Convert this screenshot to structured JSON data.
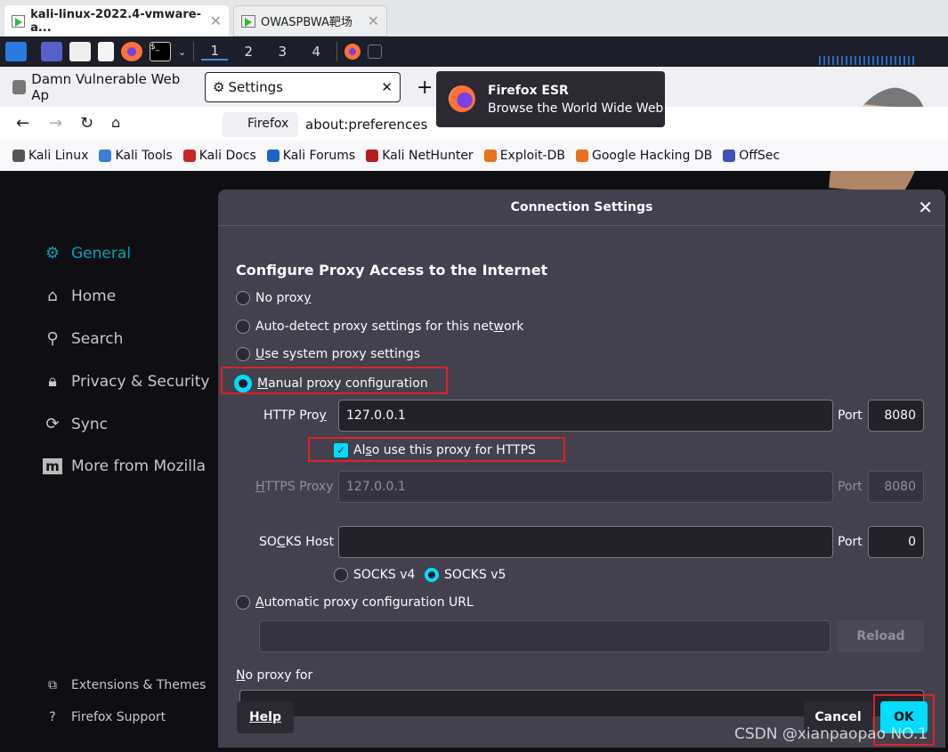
{
  "host_tabs": [
    {
      "label": "kali-linux-2022.4-vmware-a...",
      "active": true
    },
    {
      "label": "OWASPBWA靶场",
      "active": false
    }
  ],
  "panel": {
    "workspaces": [
      "1",
      "2",
      "3",
      "4"
    ]
  },
  "browser_tabs": [
    {
      "label": "Damn Vulnerable Web Ap"
    },
    {
      "label": "Settings",
      "active": true
    }
  ],
  "tooltip": {
    "title": "Firefox ESR",
    "subtitle": "Browse the World Wide Web"
  },
  "navbar": {
    "identity": "Firefox",
    "url": "about:preferences"
  },
  "bookmarks": [
    {
      "label": "Kali Linux",
      "color": "#555"
    },
    {
      "label": "Kali Tools",
      "color": "#3b7dd8"
    },
    {
      "label": "Kali Docs",
      "color": "#c62828"
    },
    {
      "label": "Kali Forums",
      "color": "#1e64c8"
    },
    {
      "label": "Kali NetHunter",
      "color": "#b71c1c"
    },
    {
      "label": "Exploit-DB",
      "color": "#e8711c"
    },
    {
      "label": "Google Hacking DB",
      "color": "#e8711c"
    },
    {
      "label": "OffSec",
      "color": "#3f51b5"
    }
  ],
  "sidebar": {
    "items": [
      {
        "label": "General",
        "icon": "gear-icon",
        "active": true
      },
      {
        "label": "Home",
        "icon": "home-icon"
      },
      {
        "label": "Search",
        "icon": "search-icon"
      },
      {
        "label": "Privacy & Security",
        "icon": "lock-icon"
      },
      {
        "label": "Sync",
        "icon": "sync-icon"
      },
      {
        "label": "More from Mozilla",
        "icon": "mozilla-icon"
      }
    ],
    "footer": [
      {
        "label": "Extensions & Themes",
        "icon": "puzzle-icon"
      },
      {
        "label": "Firefox Support",
        "icon": "help-icon"
      }
    ]
  },
  "dialog": {
    "title": "Connection Settings",
    "heading": "Configure Proxy Access to the Internet",
    "options": {
      "no_proxy": "No prox",
      "auto_detect_a": "Auto-detect proxy settings for this net",
      "auto_detect_b": "ork",
      "system_b": "se system proxy settings",
      "manual_b": "anual proxy configuration",
      "auto_url_b": "utomatic proxy configuration URL"
    },
    "selected": "manual",
    "http_proxy": {
      "label_a": "HTTP Pro",
      "label_b": "y",
      "value": "127.0.0.1",
      "port_label": "Port",
      "port": "8080"
    },
    "also_https": {
      "label_a": "Al",
      "label_b": "s",
      "label_c": "o use this proxy for HTTPS",
      "checked": true
    },
    "https_proxy": {
      "label": "TTPS Proxy",
      "value": "127.0.0.1",
      "port_label": "Port",
      "port": "8080",
      "disabled": true
    },
    "socks": {
      "label_a": "SO",
      "label_b": "C",
      "label_c": "KS Host",
      "value": "",
      "port_label": "Port",
      "port": "0",
      "v4": "SOCKS v4",
      "v5": "SOCKS v5",
      "selected": "v5"
    },
    "reload": "Reload",
    "no_proxy_for": "o proxy for",
    "help": "Help",
    "cancel": "Cancel",
    "ok": "OK",
    "accent": "#00ddff"
  },
  "watermark": "CSDN @xianpaopao NO.1"
}
